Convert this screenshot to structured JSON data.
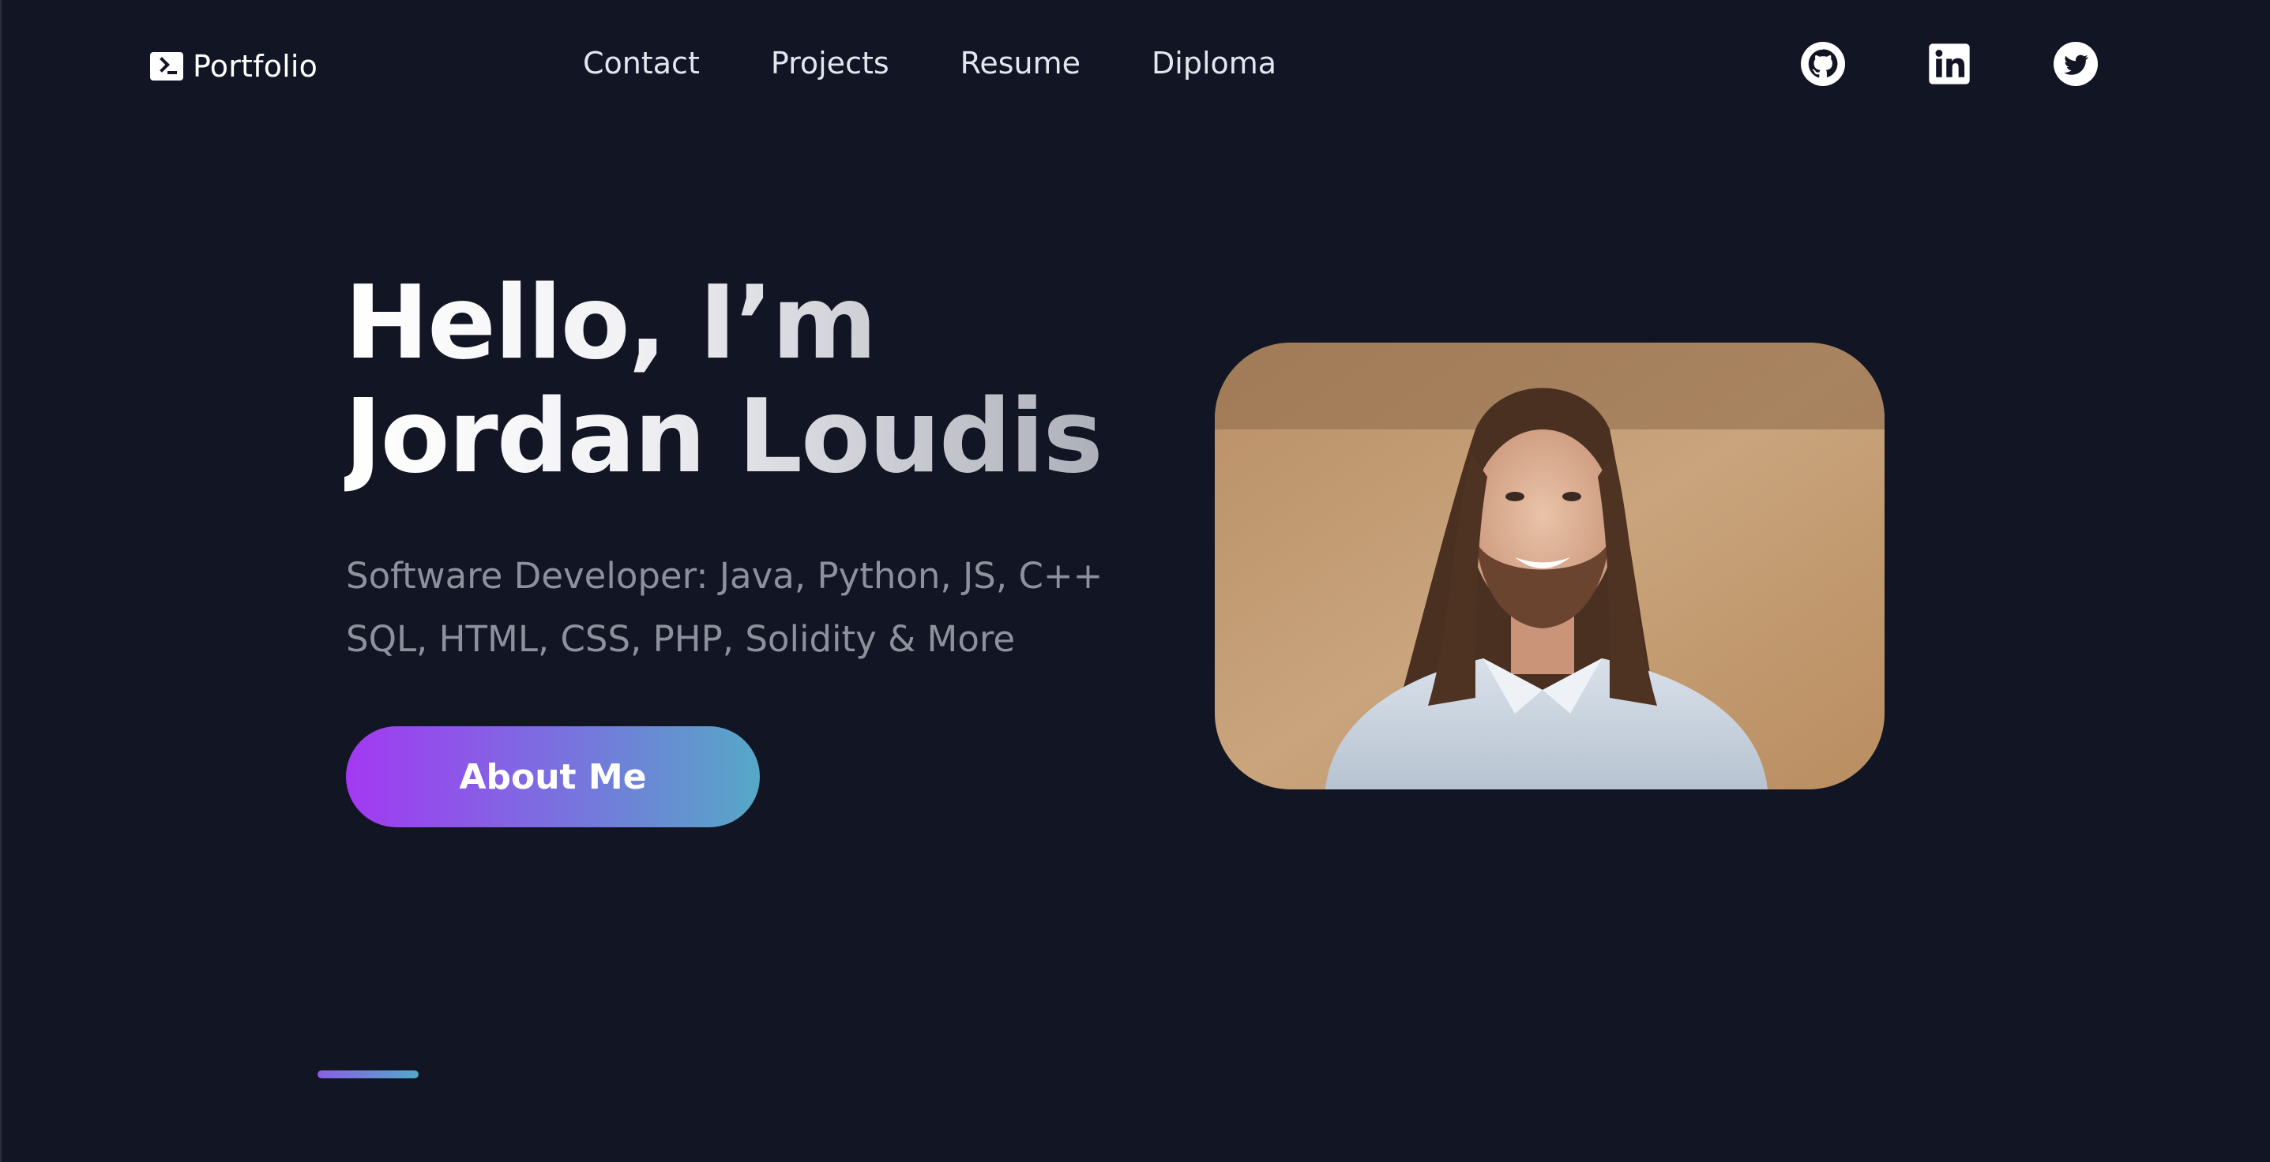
{
  "brand": {
    "label": "Portfolio",
    "icon": "terminal-icon"
  },
  "nav": {
    "items": [
      "Contact",
      "Projects",
      "Resume",
      "Diploma"
    ]
  },
  "socials": [
    {
      "name": "github",
      "icon": "github-icon"
    },
    {
      "name": "linkedin",
      "icon": "linkedin-icon"
    },
    {
      "name": "twitter",
      "icon": "twitter-icon"
    }
  ],
  "hero": {
    "title_line1": "Hello, I’m",
    "title_line2": "Jordan Loudis",
    "subtitle_line1": "Software Developer: Java, Python, JS, C++",
    "subtitle_line2": "SQL, HTML, CSS, PHP, Solidity & More",
    "cta_label": "About Me"
  },
  "colors": {
    "background": "#111524",
    "accent_start": "#a239f2",
    "accent_end": "#55a8c6",
    "subtitle": "#8e909c"
  }
}
